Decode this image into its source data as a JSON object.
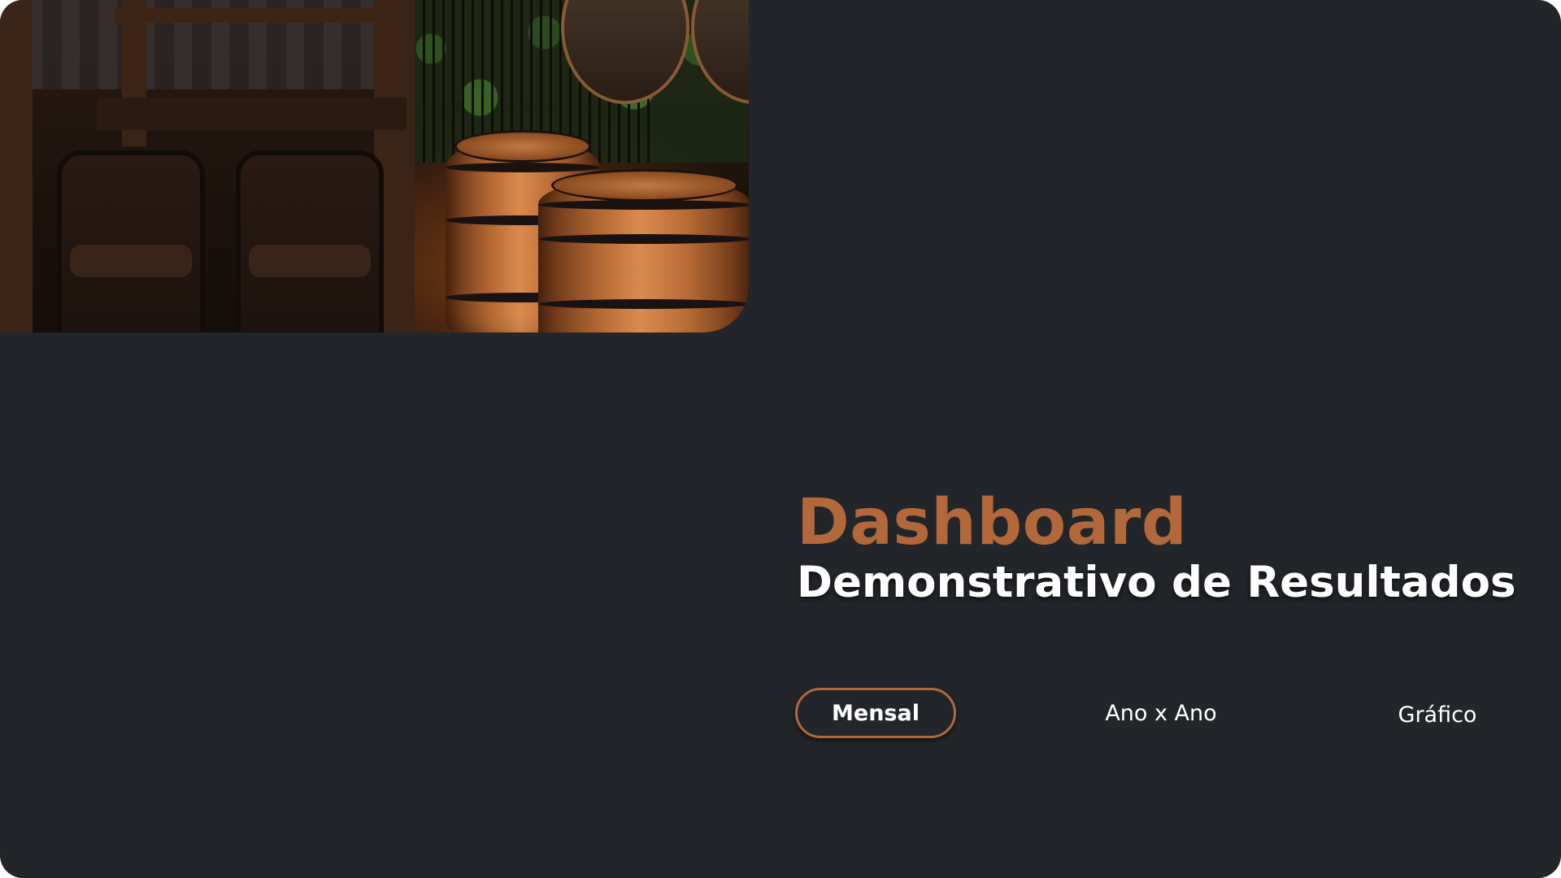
{
  "header": {
    "title": "Dashboard",
    "subtitle": "Demonstrativo de Resultados"
  },
  "nav": {
    "tabs": [
      {
        "label": "Mensal",
        "active": true
      },
      {
        "label": "Ano x Ano",
        "active": false
      },
      {
        "label": "Gráfico",
        "active": false
      }
    ]
  },
  "colors": {
    "background": "#22252a",
    "accent": "#b2683a",
    "text": "#ffffff"
  },
  "icons": {
    "hero": "wine-cellar-barrels-photo"
  }
}
